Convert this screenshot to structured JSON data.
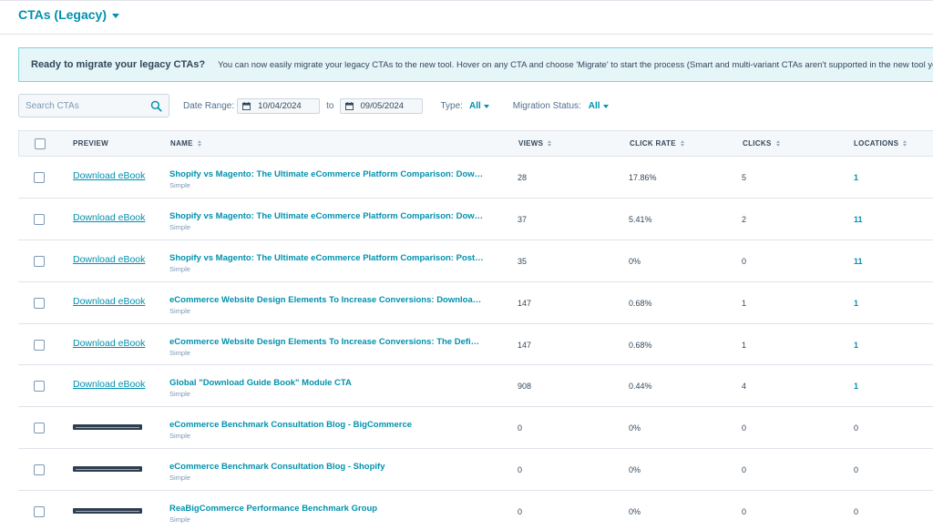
{
  "header": {
    "title": "CTAs (Legacy)"
  },
  "banner": {
    "title": "Ready to migrate your legacy CTAs?",
    "text": "You can now easily migrate your legacy CTAs to the new tool. Hover on any CTA and choose 'Migrate' to start the process (Smart and multi-variant CTAs aren't supported in the new tool yet)."
  },
  "filters": {
    "search_placeholder": "Search CTAs",
    "date_range_label": "Date Range:",
    "date_from": "10/04/2024",
    "to_label": "to",
    "date_to": "09/05/2024",
    "type_label": "Type:",
    "type_value": "All",
    "migration_label": "Migration Status:",
    "migration_value": "All"
  },
  "table": {
    "columns": {
      "preview": "PREVIEW",
      "name": "NAME",
      "views": "VIEWS",
      "click_rate": "CLICK RATE",
      "clicks": "CLICKS",
      "locations": "LOCATIONS"
    },
    "rows": [
      {
        "preview": "Download eBook",
        "name": "Shopify vs Magento: The Ultimate eCommerce Platform Comparison: Download eBook",
        "type": "Simple",
        "views": "28",
        "click_rate": "17.86%",
        "clicks": "5",
        "locations": "1"
      },
      {
        "preview": "Download eBook",
        "name": "Shopify vs Magento: The Ultimate eCommerce Platform Comparison: Download eBook",
        "type": "Simple",
        "views": "37",
        "click_rate": "5.41%",
        "clicks": "2",
        "locations": "11"
      },
      {
        "preview": "Download eBook",
        "name": "Shopify vs Magento: The Ultimate eCommerce Platform Comparison: Post eBook",
        "type": "Simple",
        "views": "35",
        "click_rate": "0%",
        "clicks": "0",
        "locations": "11"
      },
      {
        "preview": "Download eBook",
        "name": "eCommerce Website Design Elements To Increase Conversions: Download eBook",
        "type": "Simple",
        "views": "147",
        "click_rate": "0.68%",
        "clicks": "1",
        "locations": "1"
      },
      {
        "preview": "Download eBook",
        "name": "eCommerce Website Design Elements To Increase Conversions: The Definitive Guide",
        "type": "Simple",
        "views": "147",
        "click_rate": "0.68%",
        "clicks": "1",
        "locations": "1"
      },
      {
        "preview": "Download eBook",
        "name": "Global \"Download Guide Book\" Module CTA",
        "type": "Simple",
        "views": "908",
        "click_rate": "0.44%",
        "clicks": "4",
        "locations": "1"
      },
      {
        "preview": "",
        "name": "eCommerce Benchmark Consultation Blog - BigCommerce",
        "type": "Simple",
        "views": "0",
        "click_rate": "0%",
        "clicks": "0",
        "locations": "0"
      },
      {
        "preview": "",
        "name": "eCommerce Benchmark Consultation Blog - Shopify",
        "type": "Simple",
        "views": "0",
        "click_rate": "0%",
        "clicks": "0",
        "locations": "0"
      },
      {
        "preview": "",
        "name": "ReaBigCommerce Performance Benchmark Group",
        "type": "Simple",
        "views": "0",
        "click_rate": "0%",
        "clicks": "0",
        "locations": "0"
      }
    ]
  }
}
